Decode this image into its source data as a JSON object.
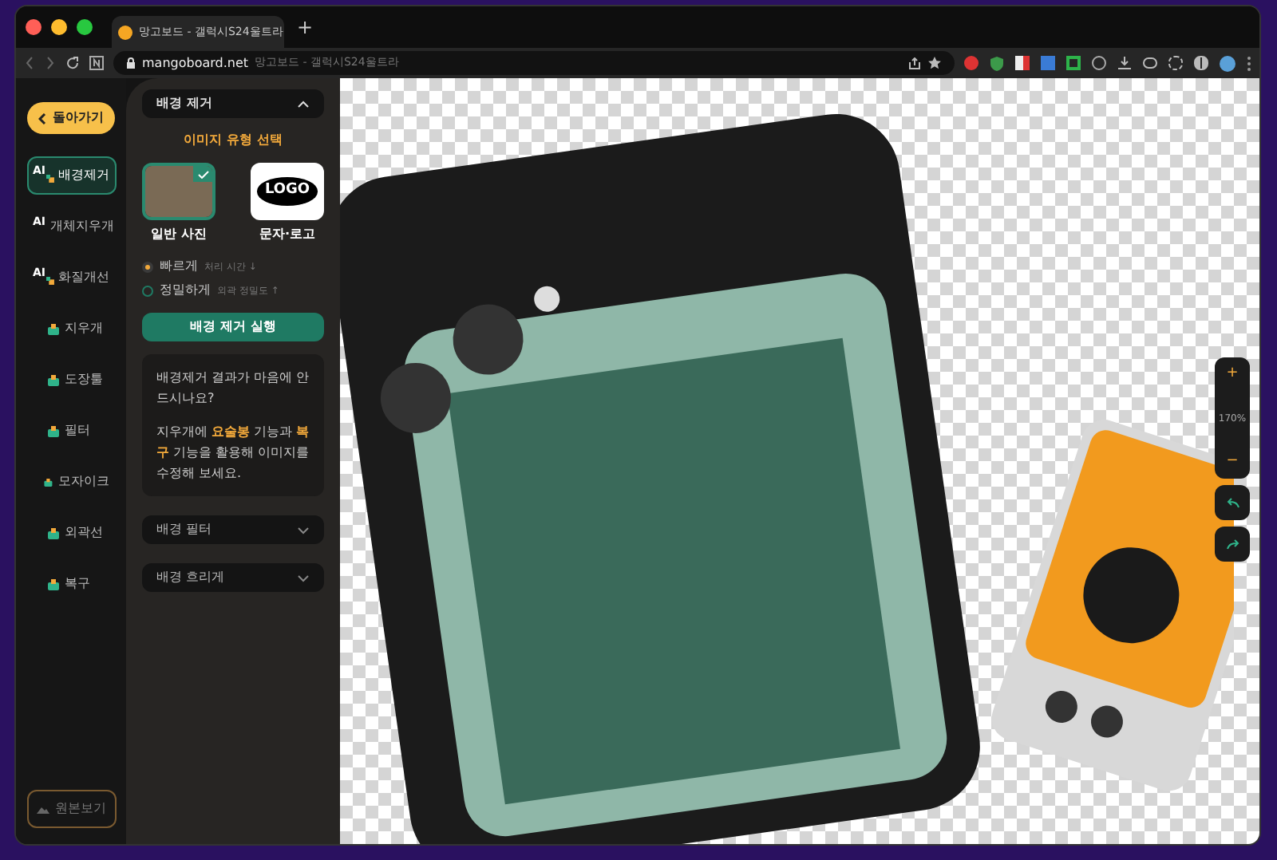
{
  "browser": {
    "tab_title": "망고보드 - 갤럭시S24울트라",
    "new_tab": "+",
    "url": "mangoboard.net",
    "page_title": "망고보드 - 갤럭시S24울트라"
  },
  "sidebar": {
    "back_button": "돌아가기",
    "tools": [
      {
        "label": "배경제거",
        "kind": "ai",
        "badge": "AI",
        "selected": true
      },
      {
        "label": "개체지우개",
        "kind": "ai",
        "badge": "AI",
        "selected": false
      },
      {
        "label": "화질개선",
        "kind": "ai",
        "badge": "AI",
        "selected": false
      },
      {
        "label": "지우개",
        "kind": "plain",
        "selected": false
      },
      {
        "label": "도장툴",
        "kind": "plain",
        "selected": false
      },
      {
        "label": "필터",
        "kind": "plain",
        "selected": false
      },
      {
        "label": "모자이크",
        "kind": "plain",
        "selected": false
      },
      {
        "label": "외곽선",
        "kind": "plain",
        "selected": false
      },
      {
        "label": "복구",
        "kind": "plain",
        "selected": false
      }
    ],
    "original_button": "원본보기"
  },
  "panel": {
    "section_title": "배경 제거",
    "expanded": true,
    "type_heading": "이미지 유형 선택",
    "types": [
      {
        "label": "일반 사진",
        "kind": "photo",
        "selected": true
      },
      {
        "label": "문자·로고",
        "kind": "logo",
        "logo_text": "LOGO",
        "selected": false
      }
    ],
    "modes": [
      {
        "label": "빠르게",
        "hint": "처리 시간 ↓",
        "selected": true
      },
      {
        "label": "정밀하게",
        "hint": "외곽 정밀도 ↑",
        "selected": false
      }
    ],
    "run_button": "배경 제거 실행",
    "tip": {
      "question": "배경제거 결과가 마음에 안드시나요?",
      "body": "지우개에 **요술봉** 기능과 **복구** 기능을 활용해 이미지를 수정해 보세요."
    },
    "sections": [
      {
        "title": "배경 필터",
        "expanded": false
      },
      {
        "title": "배경 흐리게",
        "expanded": false
      }
    ]
  },
  "zoom": {
    "zoom_in": "+",
    "level": "170%",
    "zoom_out": "−"
  }
}
